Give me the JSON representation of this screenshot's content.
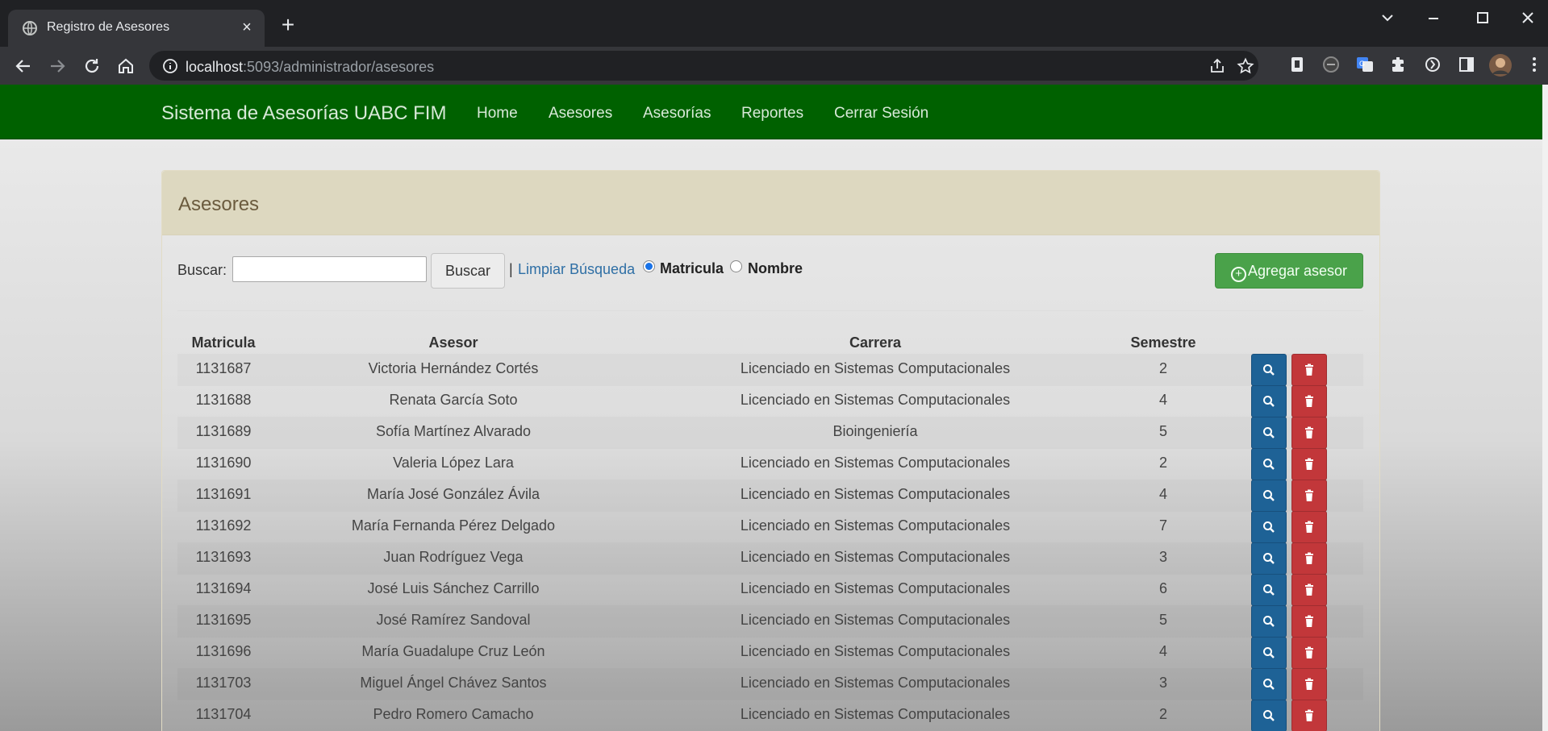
{
  "browser": {
    "tab_title": "Registro de Asesores",
    "tab_close": "×",
    "new_tab": "+",
    "url_host": "localhost",
    "url_rest": ":5093/administrador/asesores"
  },
  "navbar": {
    "brand": "Sistema de Asesorías UABC FIM",
    "links": [
      "Home",
      "Asesores",
      "Asesorías",
      "Reportes",
      "Cerrar Sesión"
    ]
  },
  "panel": {
    "title": "Asesores"
  },
  "search": {
    "label": "Buscar:",
    "value": "",
    "button": "Buscar",
    "separator": "|",
    "clear_link": "Limpiar Búsqueda",
    "radio_matricula": "Matricula",
    "radio_nombre": "Nombre",
    "selected": "Matricula"
  },
  "add_button": "Agregar asesor",
  "colors": {
    "navbar": "#006100",
    "view_button": "#1e6296",
    "delete_button": "#c2373a",
    "add_button": "#4aa24a"
  },
  "table": {
    "headers": [
      "Matricula",
      "Asesor",
      "Carrera",
      "Semestre"
    ],
    "rows": [
      {
        "matricula": "1131687",
        "asesor": "Victoria Hernández Cortés",
        "carrera": "Licenciado en Sistemas Computacionales",
        "semestre": "2"
      },
      {
        "matricula": "1131688",
        "asesor": "Renata García Soto",
        "carrera": "Licenciado en Sistemas Computacionales",
        "semestre": "4"
      },
      {
        "matricula": "1131689",
        "asesor": "Sofía Martínez Alvarado",
        "carrera": "Bioingeniería",
        "semestre": "5"
      },
      {
        "matricula": "1131690",
        "asesor": "Valeria López Lara",
        "carrera": "Licenciado en Sistemas Computacionales",
        "semestre": "2"
      },
      {
        "matricula": "1131691",
        "asesor": "María José González Ávila",
        "carrera": "Licenciado en Sistemas Computacionales",
        "semestre": "4"
      },
      {
        "matricula": "1131692",
        "asesor": "María Fernanda Pérez Delgado",
        "carrera": "Licenciado en Sistemas Computacionales",
        "semestre": "7"
      },
      {
        "matricula": "1131693",
        "asesor": "Juan Rodríguez Vega",
        "carrera": "Licenciado en Sistemas Computacionales",
        "semestre": "3"
      },
      {
        "matricula": "1131694",
        "asesor": "José Luis Sánchez Carrillo",
        "carrera": "Licenciado en Sistemas Computacionales",
        "semestre": "6"
      },
      {
        "matricula": "1131695",
        "asesor": "José Ramírez Sandoval",
        "carrera": "Licenciado en Sistemas Computacionales",
        "semestre": "5"
      },
      {
        "matricula": "1131696",
        "asesor": "María Guadalupe Cruz León",
        "carrera": "Licenciado en Sistemas Computacionales",
        "semestre": "4"
      },
      {
        "matricula": "1131703",
        "asesor": "Miguel Ángel Chávez Santos",
        "carrera": "Licenciado en Sistemas Computacionales",
        "semestre": "3"
      },
      {
        "matricula": "1131704",
        "asesor": "Pedro Romero Camacho",
        "carrera": "Licenciado en Sistemas Computacionales",
        "semestre": "2"
      }
    ]
  }
}
